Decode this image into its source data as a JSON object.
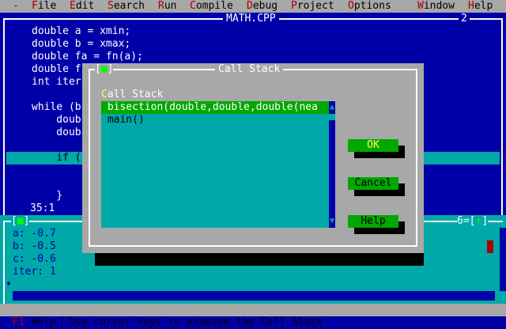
{
  "menubar": {
    "system": "-",
    "items": [
      {
        "hot": "F",
        "rest": "ile"
      },
      {
        "hot": "E",
        "rest": "dit"
      },
      {
        "hot": "S",
        "rest": "earch"
      },
      {
        "hot": "R",
        "rest": "un"
      },
      {
        "hot": "C",
        "rest": "ompile"
      },
      {
        "hot": "D",
        "rest": "ebug"
      },
      {
        "hot": "P",
        "rest": "roject"
      },
      {
        "hot": "O",
        "rest": "ptions"
      },
      {
        "hot": "W",
        "rest": "indow"
      },
      {
        "hot": "H",
        "rest": "elp"
      }
    ]
  },
  "editor": {
    "title": "MATH.CPP",
    "number": "2",
    "cursor_pos": "35:1",
    "lines": [
      "double a = xmin;",
      "double b = xmax;",
      "double fa = fn(a);",
      "double f",
      "int iter",
      "",
      "while (b",
      "    doub",
      "    doub",
      "",
      "    if (",
      "",
      "",
      "    }"
    ]
  },
  "watch": {
    "number": "6",
    "lines": [
      "a: -0.7",
      "b: -0.5",
      "c: -0.6",
      "iter: 1"
    ],
    "marker": "♦"
  },
  "dialog": {
    "title": "Call Stack",
    "list_label_hot": "C",
    "list_label_rest": "all Stack",
    "items": [
      "bisection(double,double,double(nea",
      "main()"
    ],
    "ok_label": "OK",
    "cancel_label": "Cancel",
    "help_label": "Help"
  },
  "status": {
    "key": "F1",
    "key_label": " Help ",
    "message": " Use cursor keys to examine the Call Stack"
  }
}
